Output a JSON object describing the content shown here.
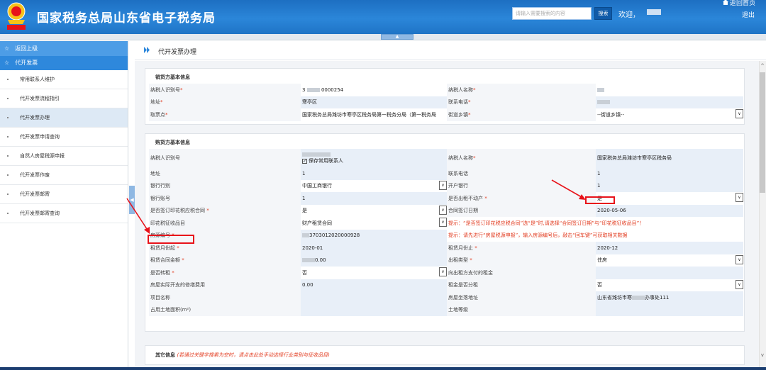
{
  "header": {
    "site_title": "国家税务总局山东省电子税务局",
    "search_placeholder": "请输入需要搜索的内容",
    "search_button": "搜索",
    "welcome": "欢迎，",
    "home_link": "返回首页",
    "logout": "退出"
  },
  "sidebar": {
    "back_label": "返回上级",
    "section_label": "代开发票",
    "items": [
      {
        "label": "常用联系人维护"
      },
      {
        "label": "代开发票流程指引"
      },
      {
        "label": "代开发票办理",
        "active": true
      },
      {
        "label": "代开发票申请查询"
      },
      {
        "label": "自然人房屋税源申报"
      },
      {
        "label": "代开发票作废"
      },
      {
        "label": "代开发票邮寄"
      },
      {
        "label": "代开发票邮寄查询"
      }
    ]
  },
  "breadcrumb": "代开发票办理",
  "seller": {
    "title": "销货方基本信息",
    "taxpayer_id_label": "纳税人识别号",
    "taxpayer_id_value_prefix": "3",
    "taxpayer_id_value_suffix": "0000254",
    "name_label": "纳税人名称",
    "address_label": "地址",
    "address_value": "寒亭区",
    "phone_label": "联系电话",
    "pickup_label": "取票点",
    "pickup_value": "国家税务总局潍坊市寒亭区税务局第一税务分局（第一税务局",
    "street_label": "街道乡镇",
    "street_value": "--街道乡镇--"
  },
  "buyer": {
    "title": "购货方基本信息",
    "taxpayer_id_label": "纳税人识别号",
    "save_contact_label": "保存常用联系人",
    "name_label": "纳税人名称",
    "name_value": "国家税务总局潍坊市寒亭区税务局",
    "address_label": "地址",
    "address_value": "1",
    "phone_label": "联系电话",
    "phone_value": "1",
    "bank_label": "银行行别",
    "bank_value": "中国工商银行",
    "open_bank_label": "开户银行",
    "open_bank_value": "1",
    "account_label": "银行账号",
    "account_value": "1",
    "rent_property_label": "是否出租不动产",
    "rent_property_value": "是",
    "stamp_contract_label": "是否签订印花税应税合同",
    "stamp_contract_value": "是",
    "contract_date_label": "合同签订日期",
    "contract_date_value": "2020-05-06",
    "stamp_item_label": "印花税征收品目",
    "stamp_item_value": "财产租赁合同",
    "hint_stamp": "提示：“是否签订印花税应税合同”选“是”时,请选择“合同签订日期”与“印花税征收品目”！",
    "house_no_label": "房源编号",
    "house_no_value": "3703012020000928",
    "hint_house": "提示：请先进行“房屋税源申报”，输入房源编号后，敲击“回车键”可获取相关数据",
    "rent_start_label": "租赁月份起",
    "rent_start_value": "2020-01",
    "rent_end_label": "租赁月份止",
    "rent_end_value": "2020-12",
    "rent_amount_label": "租赁合同金额",
    "rent_amount_value": "0.00",
    "rent_type_label": "出租类型",
    "rent_type_value": "住房",
    "sublet_label": "是否转租",
    "sublet_value": "否",
    "paid_rent_label": "向出租方支付的租金",
    "repair_label": "房屋实际开支的修缮费用",
    "repair_value": "0.00",
    "split_label": "租金是否分租",
    "split_value": "否",
    "project_label": "项目名称",
    "location_label": "房屋坐落地址",
    "location_prefix": "山东省潍坊市寒",
    "location_suffix": "办事处111",
    "land_area_label": "占用土地面积(m²)",
    "land_grade_label": "土地等级"
  },
  "other": {
    "title": "其它信息",
    "note": "(若通过关键字搜索为空时，请点击此处手动选择行业类别与征收品目)"
  },
  "colors": {
    "header_blue": "#2b86d9",
    "sidebar_head": "#2e88dc",
    "highlight_red": "#e8121a",
    "hint_red": "#e23b1f"
  }
}
